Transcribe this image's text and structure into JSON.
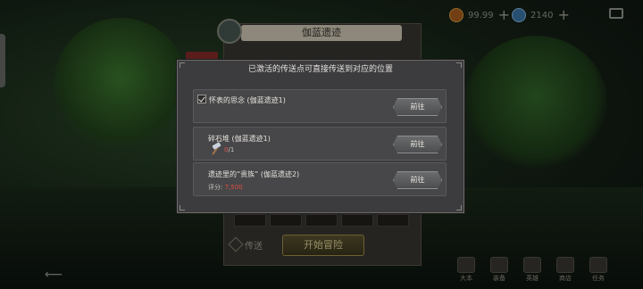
{
  "background": {
    "panel_title": "伽蓝遗迹",
    "resource_1_value": "99.99",
    "resource_2_value": "2140",
    "start_button": "开始冒险",
    "teleport_label": "传送",
    "bottom_menu": [
      "大本",
      "装备",
      "英雄",
      "商店",
      "任务"
    ]
  },
  "modal": {
    "header": "已激活的传送点可直接传送到对应的位置",
    "rows": [
      {
        "title": "怀表的思念 (伽蓝遗迹1)",
        "checked": true,
        "button": "前往"
      },
      {
        "title": "碎石堆      (伽蓝遗迹1)",
        "item_have": "0",
        "item_need": "/1",
        "button": "前往"
      },
      {
        "title": "遗迹里的“贵族” (伽蓝遗迹2)",
        "score_label": "评分:",
        "score_value": "7,500",
        "button": "前往"
      }
    ]
  }
}
